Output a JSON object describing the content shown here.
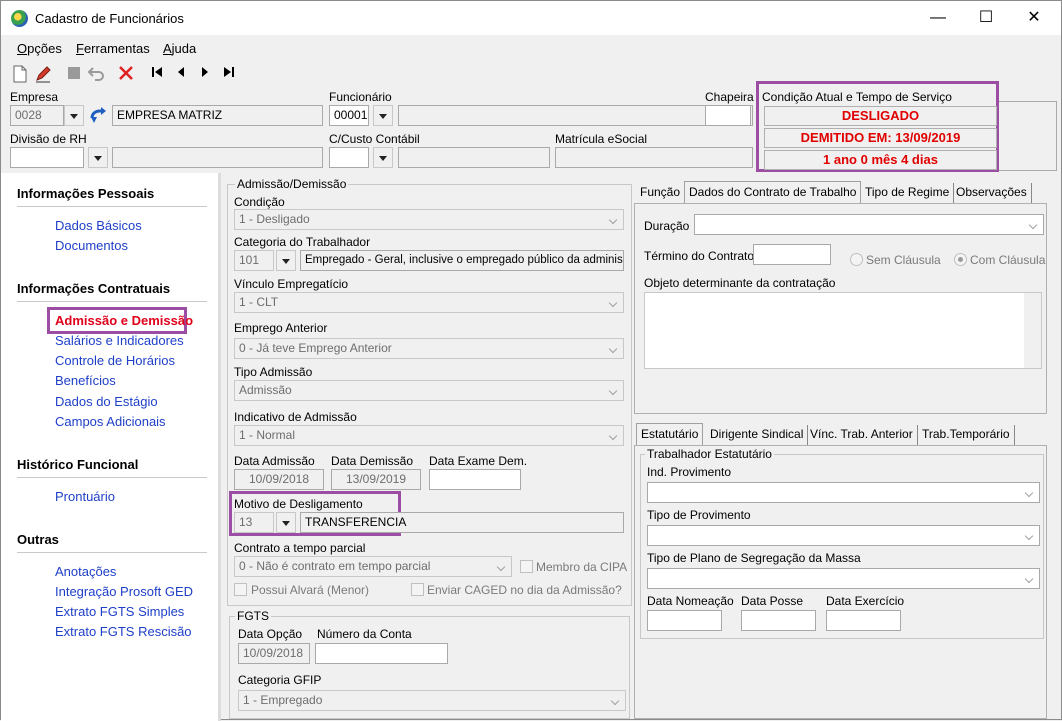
{
  "window": {
    "title": "Cadastro de Funcionários"
  },
  "menu": {
    "items": [
      {
        "u": "O",
        "rest": "pções"
      },
      {
        "u": "F",
        "rest": "erramentas"
      },
      {
        "u": "A",
        "rest": "juda"
      }
    ]
  },
  "header": {
    "empresa_label": "Empresa",
    "empresa_code": "0028",
    "empresa_name": "EMPRESA MATRIZ",
    "funcionario_label": "Funcionário",
    "funcionario_code": "00001",
    "chapeira_label": "Chapeira",
    "divisao_label": "Divisão de RH",
    "custo_label": "C/Custo Contábil",
    "matricula_label": "Matrícula eSocial",
    "status_title": "Condição Atual e Tempo de Serviço",
    "status_1": "DESLIGADO",
    "status_2": "DEMITIDO EM: 13/09/2019",
    "status_3": "1 ano 0 mês 4 dias"
  },
  "sidebar": {
    "sec1": "Informações Pessoais",
    "sec1_items": [
      "Dados Básicos",
      "Documentos"
    ],
    "sec2": "Informações Contratuais",
    "sec2_items": [
      "Admissão e Demissão",
      "Salários e Indicadores",
      "Controle de Horários",
      "Benefícios",
      "Dados do Estágio",
      "Campos Adicionais"
    ],
    "sec3": "Histórico Funcional",
    "sec3_items": [
      "Prontuário"
    ],
    "sec4": "Outras",
    "sec4_items": [
      "Anotações",
      "Integração Prosoft GED",
      "Extrato FGTS Simples",
      "Extrato FGTS Rescisão"
    ]
  },
  "admissao": {
    "group": "Admissão/Demissão",
    "condicao_label": "Condição",
    "condicao_value": "1 - Desligado",
    "categoria_label": "Categoria do Trabalhador",
    "categoria_code": "101",
    "categoria_desc": "Empregado - Geral, inclusive o empregado público da administ",
    "vinculo_label": "Vínculo Empregatício",
    "vinculo_value": "1 - CLT",
    "emprego_label": "Emprego Anterior",
    "emprego_value": "0 - Já teve Emprego Anterior",
    "tipo_label": "Tipo Admissão",
    "tipo_value": "Admissão",
    "indicativo_label": "Indicativo de Admissão",
    "indicativo_value": "1 - Normal",
    "data_adm_label": "Data Admissão",
    "data_adm_value": "10/09/2018",
    "data_dem_label": "Data Demissão",
    "data_dem_value": "13/09/2019",
    "data_exame_label": "Data Exame Dem.",
    "motivo_label": "Motivo de Desligamento",
    "motivo_code": "13",
    "motivo_desc": "TRANSFERENCIA",
    "contrato_label": "Contrato a tempo parcial",
    "contrato_value": "0 - Não é contrato em tempo parcial",
    "membro_cipa": "Membro da CIPA",
    "possui_alvara": "Possui Alvará (Menor)",
    "enviar_caged": "Enviar CAGED no dia da Admissão?"
  },
  "fgts": {
    "group": "FGTS",
    "data_opcao_label": "Data Opção",
    "data_opcao_value": "10/09/2018",
    "numero_label": "Número da Conta",
    "categoria_label": "Categoria GFIP",
    "categoria_value": "1 - Empregado"
  },
  "contrato_tabs": {
    "tabs": [
      "Função",
      "Dados do Contrato de Trabalho",
      "Tipo de Regime",
      "Observações"
    ],
    "duracao_label": "Duração",
    "termino_label": "Término do Contrato",
    "sem_clausula": "Sem Cláusula",
    "com_clausula": "Com Cláusula",
    "objeto_label": "Objeto determinante da contratação"
  },
  "estatutario_tabs": {
    "tabs": [
      "Estatutário",
      "Dirigente Sindical",
      "Vínc. Trab. Anterior",
      "Trab.Temporário"
    ],
    "group": "Trabalhador Estatutário",
    "ind_label": "Ind. Provimento",
    "tipo_prov_label": "Tipo de Provimento",
    "plano_label": "Tipo de Plano de Segregação da Massa",
    "nomeacao_label": "Data Nomeação",
    "posse_label": "Data Posse",
    "exercicio_label": "Data Exercício"
  }
}
